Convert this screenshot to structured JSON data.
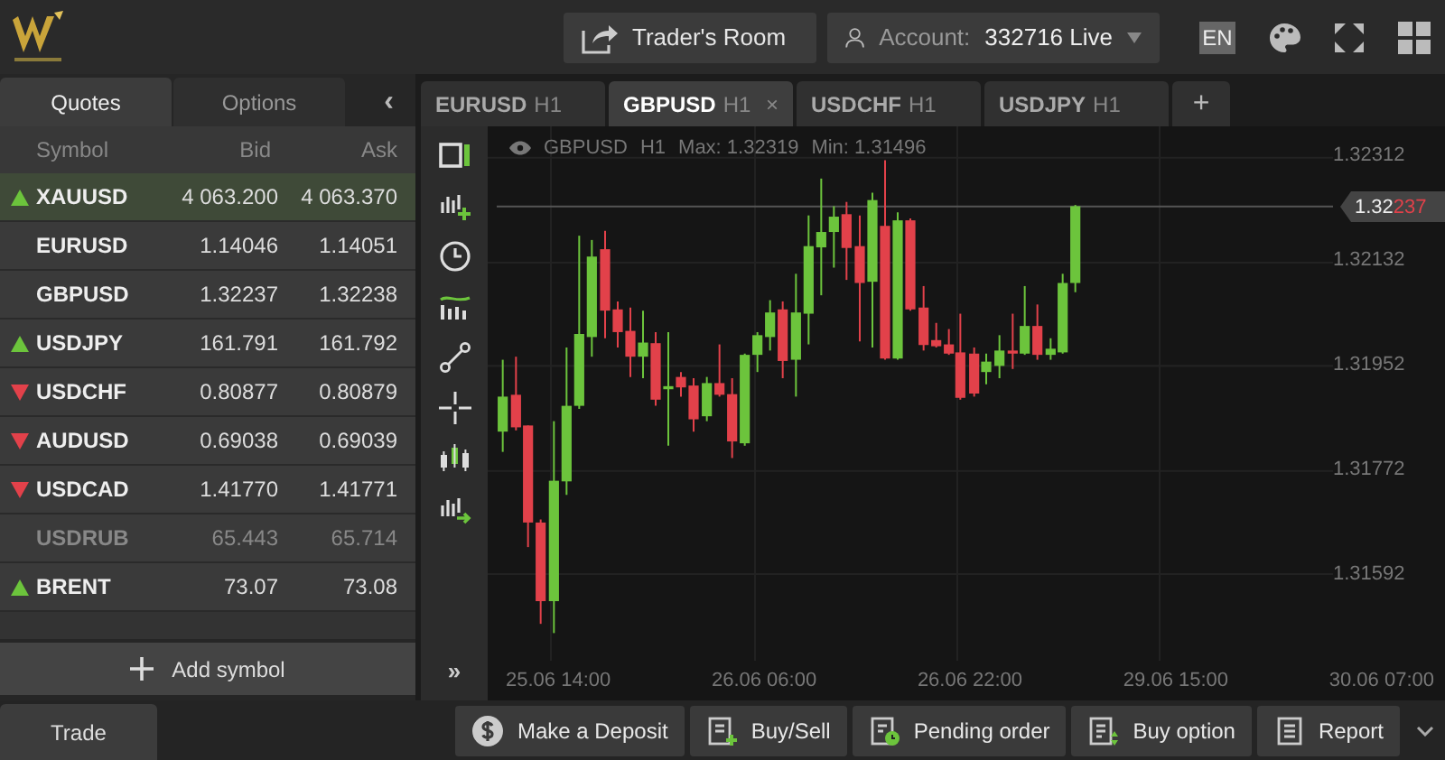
{
  "header": {
    "traders_room": "Trader's Room",
    "account_label": "Account:",
    "account_value": "332716 Live",
    "language": "EN"
  },
  "left_tabs": [
    {
      "label": "Quotes",
      "selected": true
    },
    {
      "label": "Options",
      "selected": false
    }
  ],
  "collapse": "‹",
  "quotes": {
    "columns": [
      "Symbol",
      "Bid",
      "Ask"
    ],
    "rows": [
      {
        "symbol": "XAUUSD",
        "bid": "4 063.200",
        "ask": "4 063.370",
        "kind": "up",
        "selected": true,
        "disabled": false
      },
      {
        "symbol": "EURUSD",
        "bid": "1.14046",
        "ask": "1.14051",
        "kind": "flat",
        "selected": false,
        "disabled": false
      },
      {
        "symbol": "GBPUSD",
        "bid": "1.32237",
        "ask": "1.32238",
        "kind": "flat",
        "selected": false,
        "disabled": false
      },
      {
        "symbol": "USDJPY",
        "bid": "161.791",
        "ask": "161.792",
        "kind": "up",
        "selected": false,
        "disabled": false
      },
      {
        "symbol": "USDCHF",
        "bid": "0.80877",
        "ask": "0.80879",
        "kind": "down",
        "selected": false,
        "disabled": false
      },
      {
        "symbol": "AUDUSD",
        "bid": "0.69038",
        "ask": "0.69039",
        "kind": "down",
        "selected": false,
        "disabled": false
      },
      {
        "symbol": "USDCAD",
        "bid": "1.41770",
        "ask": "1.41771",
        "kind": "down",
        "selected": false,
        "disabled": false
      },
      {
        "symbol": "USDRUB",
        "bid": "65.443",
        "ask": "65.714",
        "kind": "flat",
        "selected": false,
        "disabled": true
      },
      {
        "symbol": "BRENT",
        "bid": "73.07",
        "ask": "73.08",
        "kind": "up",
        "selected": false,
        "disabled": false
      }
    ],
    "add_symbol": "Add symbol"
  },
  "chart_tabs": [
    {
      "symbol": "EURUSD",
      "period": "H1",
      "selected": false
    },
    {
      "symbol": "GBPUSD",
      "period": "H1",
      "selected": true
    },
    {
      "symbol": "USDCHF",
      "period": "H1",
      "selected": false
    },
    {
      "symbol": "USDJPY",
      "period": "H1",
      "selected": false
    }
  ],
  "chart_tab_close": "×",
  "chart_tab_add": "+",
  "toolbar_more": "»",
  "chart": {
    "info": [
      "GBPUSD",
      "H1",
      "Max: 1.32319",
      "Min: 1.31496"
    ],
    "price_ticks": [
      "1.32312",
      "1.32132",
      "1.31952",
      "1.31772",
      "1.31592"
    ],
    "time_ticks": [
      "25.06 14:00",
      "26.06 06:00",
      "26.06 22:00",
      "29.06 15:00",
      "30.06 07:00"
    ],
    "current_price": {
      "main": "1.32",
      "pips": "237"
    }
  },
  "bottom_tabs": [
    {
      "label": "Trade",
      "selected": true
    }
  ],
  "actions": [
    {
      "label": "Make a Deposit",
      "kind": "deposit"
    },
    {
      "label": "Buy/Sell",
      "kind": "buysell"
    },
    {
      "label": "Pending order",
      "kind": "pending"
    },
    {
      "label": "Buy option",
      "kind": "option"
    },
    {
      "label": "Report",
      "kind": "report"
    }
  ]
}
